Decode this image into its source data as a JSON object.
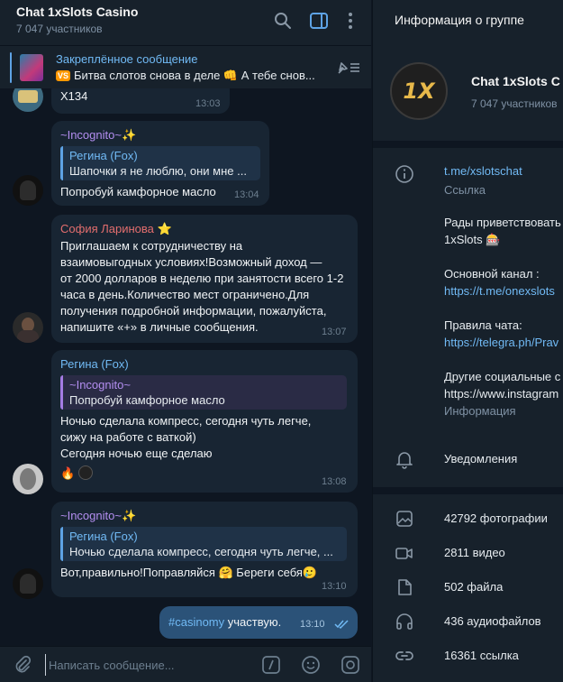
{
  "chat": {
    "title": "Chat 1xSlots Casino",
    "members": "7 047 участников",
    "pinned": {
      "label": "Закреплённое сообщение",
      "badge": "VS",
      "text": "Битва слотов снова в деле 👊 А тебе снов..."
    },
    "messages": [
      {
        "text": "X134",
        "time": "13:03"
      },
      {
        "sender": "~Incognito~",
        "sender_emoji": "✨",
        "reply_name": "Регина (Fox)",
        "reply_text": "Шапочки я не люблю, они мне ...",
        "text": "Попробуй камфорное масло",
        "time": "13:04"
      },
      {
        "sender": "София Ларинова",
        "sender_emoji": "⭐",
        "lines": [
          "Приглашаем к сотрудничеству на",
          "взаимовыгодных условиях!Возможный доход —",
          "от 2000 долларов в неделю при занятости всего 1-2",
          "часа в день.Количество мест ограничено.Для",
          "получения подробной информации, пожалуйста,",
          "напишите «+» в личные сообщения."
        ],
        "time": "13:07"
      },
      {
        "sender": "Регина (Fox)",
        "reply_name": "~Incognito~",
        "reply_text": "Попробуй камфорное масло",
        "lines": [
          "Ночью сделала компресс, сегодня чуть легче,",
          "сижу на работе с ваткой)",
          "Сегодня ночью еще сделаю"
        ],
        "reaction": "🔥",
        "time": "13:08"
      },
      {
        "sender": "~Incognito~",
        "sender_emoji": "✨",
        "reply_name": "Регина (Fox)",
        "reply_text": "Ночью сделала компресс, сегодня чуть легче, ...",
        "text": "Вот,правильно!Поправляйся 🤗 Береги себя🥲",
        "time": "13:10"
      },
      {
        "hashtag": "#casinomy",
        "text": " участвую.",
        "time": "13:10"
      }
    ],
    "composer_placeholder": "Написать сообщение..."
  },
  "info": {
    "title": "Информация о группе",
    "name": "Chat 1xSlots C",
    "count": "7 047 участников",
    "avatar_text": "1X",
    "link": "t.me/xslotschat",
    "link_label": "Ссылка",
    "desc_lines": [
      "Рады приветствовать",
      "1xSlots 🎰",
      "",
      "Основной канал :",
      "https://t.me/onexslots",
      "",
      "Правила чата:",
      "https://telegra.ph/Prav",
      "",
      "Другие социальные с",
      "https://www.instagram"
    ],
    "desc_label": "Информация",
    "notifications": "Уведомления",
    "media": [
      {
        "icon": "photo-icon",
        "label": "42792 фотографии"
      },
      {
        "icon": "video-icon",
        "label": "2811 видео"
      },
      {
        "icon": "file-icon",
        "label": "502 файла"
      },
      {
        "icon": "headphones-icon",
        "label": "436 аудиофайлов"
      },
      {
        "icon": "link-icon",
        "label": "16361 ссылка"
      }
    ]
  },
  "colors": {
    "bg": "#0e1621",
    "panel": "#17212b",
    "bubble_in": "#182533",
    "bubble_out": "#2b5278",
    "accent": "#71baf5",
    "name_purple": "#b38ef0",
    "name_red": "#e46e6e"
  }
}
